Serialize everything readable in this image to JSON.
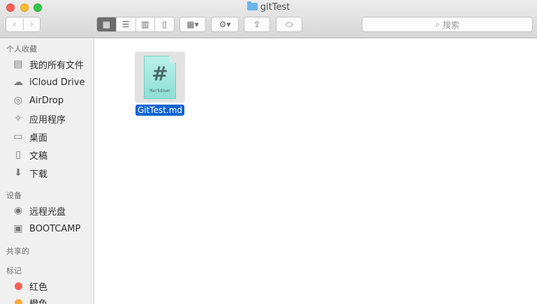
{
  "window": {
    "title": "gitTest"
  },
  "toolbar": {
    "back": "‹",
    "forward": "›",
    "search_placeholder": "搜索"
  },
  "sidebar": {
    "favorites_header": "个人收藏",
    "favorites": [
      {
        "label": "我的所有文件",
        "icon": "all-files-icon"
      },
      {
        "label": "iCloud Drive",
        "icon": "cloud-icon"
      },
      {
        "label": "AirDrop",
        "icon": "airdrop-icon"
      },
      {
        "label": "应用程序",
        "icon": "applications-icon"
      },
      {
        "label": "桌面",
        "icon": "desktop-icon"
      },
      {
        "label": "文稿",
        "icon": "documents-icon"
      },
      {
        "label": "下载",
        "icon": "downloads-icon"
      }
    ],
    "devices_header": "设备",
    "devices": [
      {
        "label": "远程光盘",
        "icon": "remote-disc-icon"
      },
      {
        "label": "BOOTCAMP",
        "icon": "drive-icon"
      }
    ],
    "shared_header": "共享的",
    "tags_header": "标记",
    "tags": [
      {
        "label": "红色",
        "color": "#fc5f57"
      },
      {
        "label": "橙色",
        "color": "#fdaa3a"
      }
    ]
  },
  "files": [
    {
      "name": "GitTest.md",
      "thumb_symbol": "#",
      "thumb_label": "Markdown"
    }
  ],
  "colors": {
    "selection": "#0f64d2",
    "accent": "#6ab4e8"
  }
}
